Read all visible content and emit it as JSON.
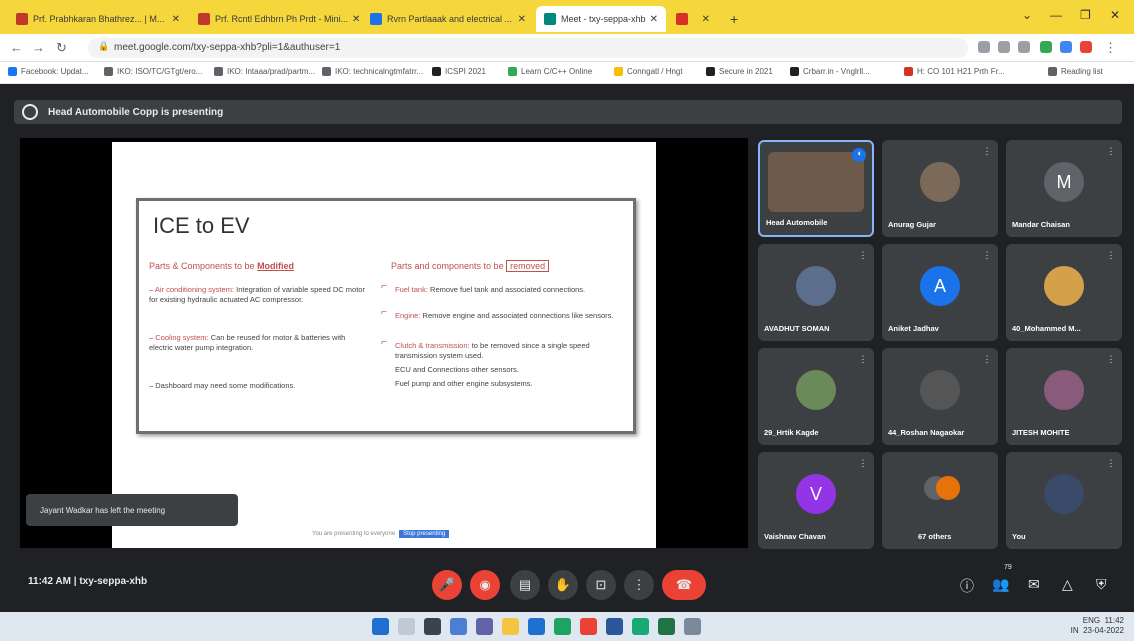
{
  "browser": {
    "tabs": [
      {
        "label": "Prf. Prabhkaran Bhathrez... | M...",
        "color": "#c0392b"
      },
      {
        "label": "Prf. Rcntl Edhbrn Ph Prdt - Mini...",
        "color": "#c0392b"
      },
      {
        "label": "Rvrn Partlaaak and electrical ...",
        "color": "#1a73e8"
      },
      {
        "label": "Meet - txy-seppa-xhb",
        "color": "#00897b"
      },
      {
        "label": "",
        "color": "#d93025"
      }
    ],
    "new_tab_label": "+",
    "url": "meet.google.com/txy-seppa-xhb?pli=1&authuser=1",
    "bookmarks": [
      "Facebook: Updat...",
      "IKO: ISO/TC/GTgt/ero...",
      "IKO: Intaaa/prad/partm...",
      "IKO: technicalngtmfatrr...",
      "ICSPI 2021",
      "Learn C/C++ Online",
      "Conngatl / Hngt",
      "Secure in 2021",
      "Crbarr.in - Vnglrll...",
      "H: CO 101 H21 Prth Fr..."
    ],
    "reading_list": "Reading list"
  },
  "meet": {
    "presenting_banner": "Head Automobile Copp is presenting",
    "slide": {
      "title": "ICE to EV",
      "left_heading": "Parts & Components to be ",
      "left_heading_key": "Modified",
      "right_heading": "Parts and components to be ",
      "right_heading_key": "removed",
      "left_items": [
        [
          "Air conditioning system: ",
          "Integration of variable speed DC motor for existing hydraulic actuated AC compressor."
        ],
        [
          "Cooling system: ",
          "Can be reused for motor & batteries with electric water pump integration."
        ],
        [
          "",
          "Dashboard may need some modifications."
        ]
      ],
      "right_items": [
        [
          "Fuel tank: ",
          "Remove fuel tank and associated connections."
        ],
        [
          "Engine: ",
          "Remove engine and associated connections like sensors."
        ],
        [
          "Clutch & transmission: ",
          "to be removed since a single speed transmission system used."
        ],
        [
          "",
          "ECU and Connections other sensors."
        ],
        [
          "",
          "Fuel pump and other engine subsystems."
        ]
      ],
      "footer_text": "You are presenting to everyone",
      "footer_button": "Stop presenting"
    },
    "toast": "Jayant Wadkar has left the meeting",
    "participants": [
      {
        "name": "Head Automobile",
        "initial": "",
        "avatar_color": "#6d5a4a",
        "speaking": true
      },
      {
        "name": "Anurag Gujar",
        "initial": "",
        "avatar_color": "#7b6a58",
        "speaking": false
      },
      {
        "name": "Mandar Chaisan",
        "initial": "M",
        "avatar_color": "#5f6368",
        "speaking": false
      },
      {
        "name": "AVADHUT SOMAN",
        "initial": "",
        "avatar_color": "#5b6f8c",
        "speaking": false
      },
      {
        "name": "Aniket Jadhav",
        "initial": "A",
        "avatar_color": "#1a73e8",
        "speaking": false
      },
      {
        "name": "40_Mohammed M...",
        "initial": "",
        "avatar_color": "#d4a04a",
        "speaking": false
      },
      {
        "name": "29_Hrtik Kagde",
        "initial": "",
        "avatar_color": "#6a8a5a",
        "speaking": false
      },
      {
        "name": "44_Roshan Nagaokar",
        "initial": "",
        "avatar_color": "#555555",
        "speaking": false
      },
      {
        "name": "JITESH MOHITE",
        "initial": "",
        "avatar_color": "#8a5a7a",
        "speaking": false
      },
      {
        "name": "Vaishnav Chavan",
        "initial": "V",
        "avatar_color": "#9334e6",
        "speaking": false
      },
      {
        "name": "67 others",
        "initial": "",
        "avatar_color": "#5f6368",
        "speaking": false
      },
      {
        "name": "You",
        "initial": "",
        "avatar_color": "#3a4a6a",
        "speaking": false
      }
    ],
    "time_code": "11:42 AM  |  txy-seppa-xhb",
    "participant_count": "79"
  },
  "taskbar": {
    "tray_top": "ENG",
    "tray_bottom": "IN",
    "clock_time": "11:42",
    "clock_date": "23-04-2022"
  },
  "colors": {
    "tab_strip": "#f5d63b",
    "meet_bg": "#202124",
    "tile_bg": "#3c4043",
    "end_call": "#ea4335",
    "accent": "#c0504d"
  }
}
